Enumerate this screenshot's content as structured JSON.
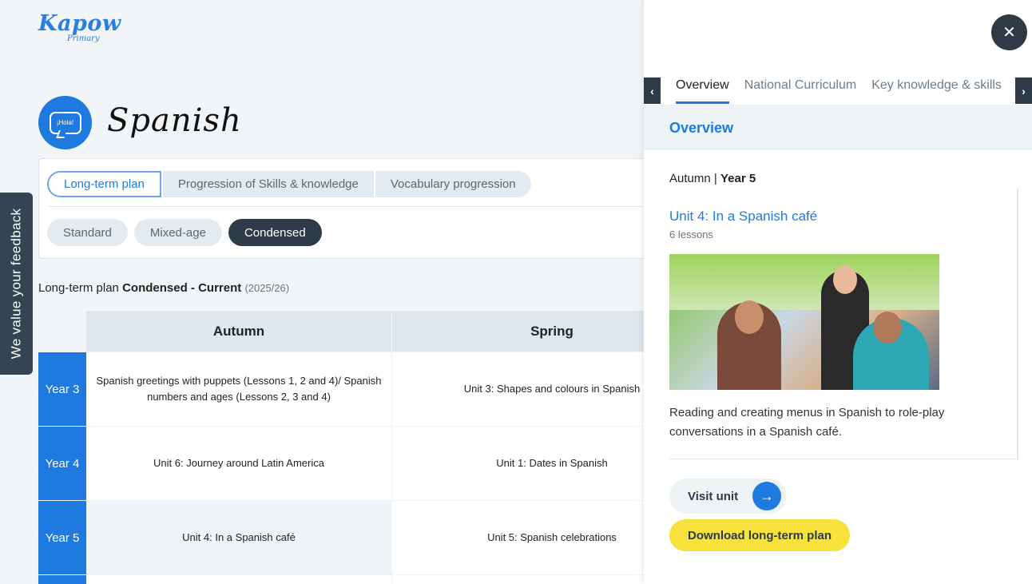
{
  "logo": {
    "line1": "Kapow",
    "line2": "Primary"
  },
  "subject": {
    "icon_text": "¡Hola!",
    "title": "Spanish"
  },
  "plan_tabs": [
    "Long-term plan",
    "Progression of Skills & knowledge",
    "Vocabulary progression"
  ],
  "plan_types": [
    "Standard",
    "Mixed-age",
    "Condensed"
  ],
  "caption": {
    "prefix": "Long-term plan",
    "bold": "Condensed - Current",
    "year": "(2025/26)"
  },
  "table": {
    "headers": [
      "Autumn",
      "Spring"
    ],
    "rows": [
      {
        "label": "Year 3",
        "autumn": "Spanish greetings with puppets (Lessons 1, 2 and 4)/ Spanish numbers and ages (Lessons 2, 3 and 4)",
        "spring": "Unit 3: Shapes and colours in Spanish"
      },
      {
        "label": "Year 4",
        "autumn": "Unit 6: Journey around Latin America",
        "spring": "Unit 1: Dates in Spanish"
      },
      {
        "label": "Year 5",
        "autumn": "Unit 4: In a Spanish café",
        "spring": "Unit 5: Spanish celebrations"
      }
    ]
  },
  "feedback": "We value your feedback",
  "panel": {
    "tabs": [
      "Overview",
      "National Curriculum",
      "Key knowledge & skills"
    ],
    "heading": "Overview",
    "term": "Autumn",
    "separator": "|",
    "year": "Year 5",
    "unit_title": "Unit 4: In a Spanish café",
    "lessons": "6 lessons",
    "description": "Reading and creating menus in Spanish to role-play conversations in a Spanish café.",
    "visit_label": "Visit unit",
    "download_label": "Download long-term plan"
  },
  "icons": {
    "close": "close-icon",
    "prev": "chevron-left-icon",
    "next": "chevron-right-icon",
    "visit": "arrow-right-icon"
  },
  "colors": {
    "brand_blue": "#1f7ae0",
    "dark": "#2e3a48",
    "yellow": "#f7e23b"
  }
}
